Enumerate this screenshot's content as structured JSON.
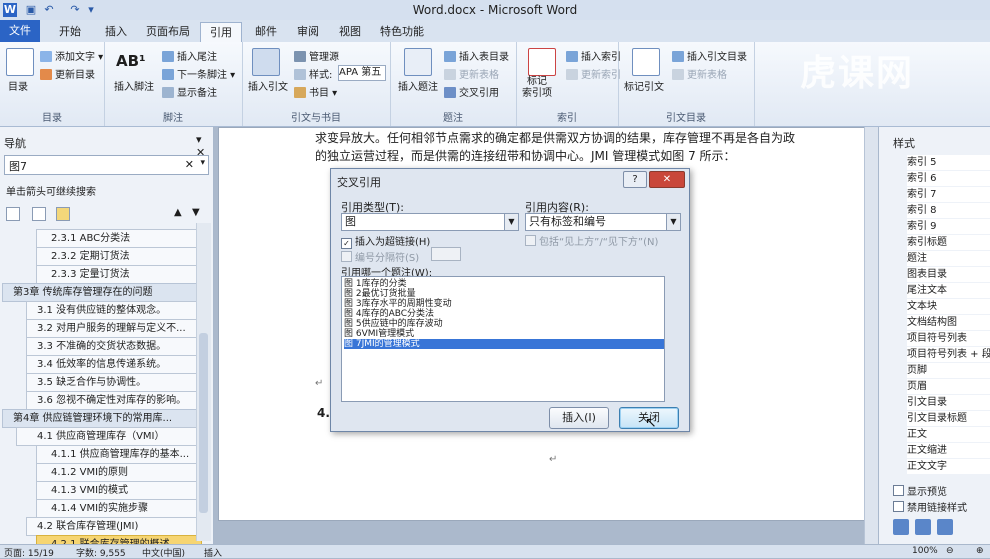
{
  "window": {
    "title": "Word.docx - Microsoft Word"
  },
  "tabs": [
    "文件",
    "开始",
    "插入",
    "页面布局",
    "引用",
    "邮件",
    "审阅",
    "视图",
    "特色功能"
  ],
  "ribbon": {
    "groups": {
      "toc": {
        "label": "目录",
        "big": "目录",
        "small": [
          "添加文字",
          "更新目录"
        ]
      },
      "footnote": {
        "label": "脚注",
        "big": "插入脚注",
        "small": [
          "插入尾注",
          "下一条脚注",
          "显示备注"
        ],
        "big_icon_text": "AB¹"
      },
      "citation": {
        "label": "引文与书目",
        "big": "插入引文",
        "small": [
          "管理源",
          "样式:",
          "书目"
        ],
        "style_value": "APA 第五"
      },
      "caption": {
        "label": "题注",
        "big": "插入题注",
        "small": [
          "插入表目录",
          "更新表格",
          "交叉引用"
        ]
      },
      "index": {
        "label": "索引",
        "big": "标记\n索引项",
        "small": [
          "插入索引",
          "更新索引"
        ]
      },
      "authorities": {
        "label": "引文目录",
        "big": "标记引文",
        "small": [
          "插入引文目录",
          "更新表格"
        ]
      }
    }
  },
  "nav": {
    "title": "导航",
    "search_value": "图7",
    "hint": "单击箭头可继续搜索",
    "items": [
      "2.3.1 ABC分类法",
      "2.3.2 定期订货法",
      "2.3.3 定量订货法",
      "第3章 传统库存管理存在的问题",
      "3.1 没有供应链的整体观念。",
      "3.2 对用户服务的理解与定义不...",
      "3.3 不准确的交货状态数据。",
      "3.4 低效率的信息传递系统。",
      "3.5 缺乏合作与协调性。",
      "3.6 忽视不确定性对库存的影响。",
      "第4章 供应链管理环境下的常用库...",
      "4.1 供应商管理库存（VMI）",
      "4.1.1 供应商管理库存的基本...",
      "4.1.2 VMI的原则",
      "4.1.3 VMI的模式",
      "4.1.4 VMI的实施步骤",
      "4.2 联合库存管理(JMI)",
      "4.2.1 联合库存管理的概述"
    ]
  },
  "document": {
    "line1": "求变异放大。任何相邻节点需求的确定都是供需双方协调的结果，库存管理不再是各自为政",
    "line2": "的独立运营过程，而是供需的连接纽带和协调中心。JMI 管理模式如图 7 所示：",
    "heading": "4.",
    "para_mark": "↵"
  },
  "dialog": {
    "title": "交叉引用",
    "ref_type_label": "引用类型(T):",
    "ref_type_value": "图",
    "ref_content_label": "引用内容(R):",
    "ref_content_value": "只有标签和编号",
    "insert_hyperlink": "插入为超链接(H)",
    "include_above_below": "包括“见上方”/“见下方”(N)",
    "number_sep": "编号分隔符(S)",
    "which_caption_label": "引用哪一个题注(W):",
    "captions": [
      "图 1库存的分类",
      "图 2最优订货批量",
      "图 3库存水平的周期性变动",
      "图 4库存的ABC分类法",
      "图 5供应链中的库存波动",
      "图 6VMI管理模式",
      "图 7JMI的管理模式"
    ],
    "insert_button": "插入(I)",
    "close_button": "关闭"
  },
  "styles": {
    "title": "样式",
    "items": [
      "索引 5",
      "索引 6",
      "索引 7",
      "索引 8",
      "索引 9",
      "索引标题",
      "题注",
      "图表目录",
      "尾注文本",
      "文本块",
      "文档结构图",
      "项目符号列表",
      "项目符号列表 + 段",
      "页脚",
      "页眉",
      "引文目录",
      "引文目录标题",
      "正文",
      "正文缩进",
      "正文文字"
    ],
    "show_preview": "显示预览",
    "disable_linked": "禁用链接样式"
  },
  "status": {
    "page": "页面: 15/19",
    "words": "字数: 9,555",
    "lang": "中文(中国)",
    "mode": "插入",
    "zoom": "100%"
  },
  "watermark": "虎课网",
  "colors": {
    "file_tab": "#2b64c5",
    "selected_caption": "#3875d7",
    "nav_selected": "#f6d572"
  }
}
